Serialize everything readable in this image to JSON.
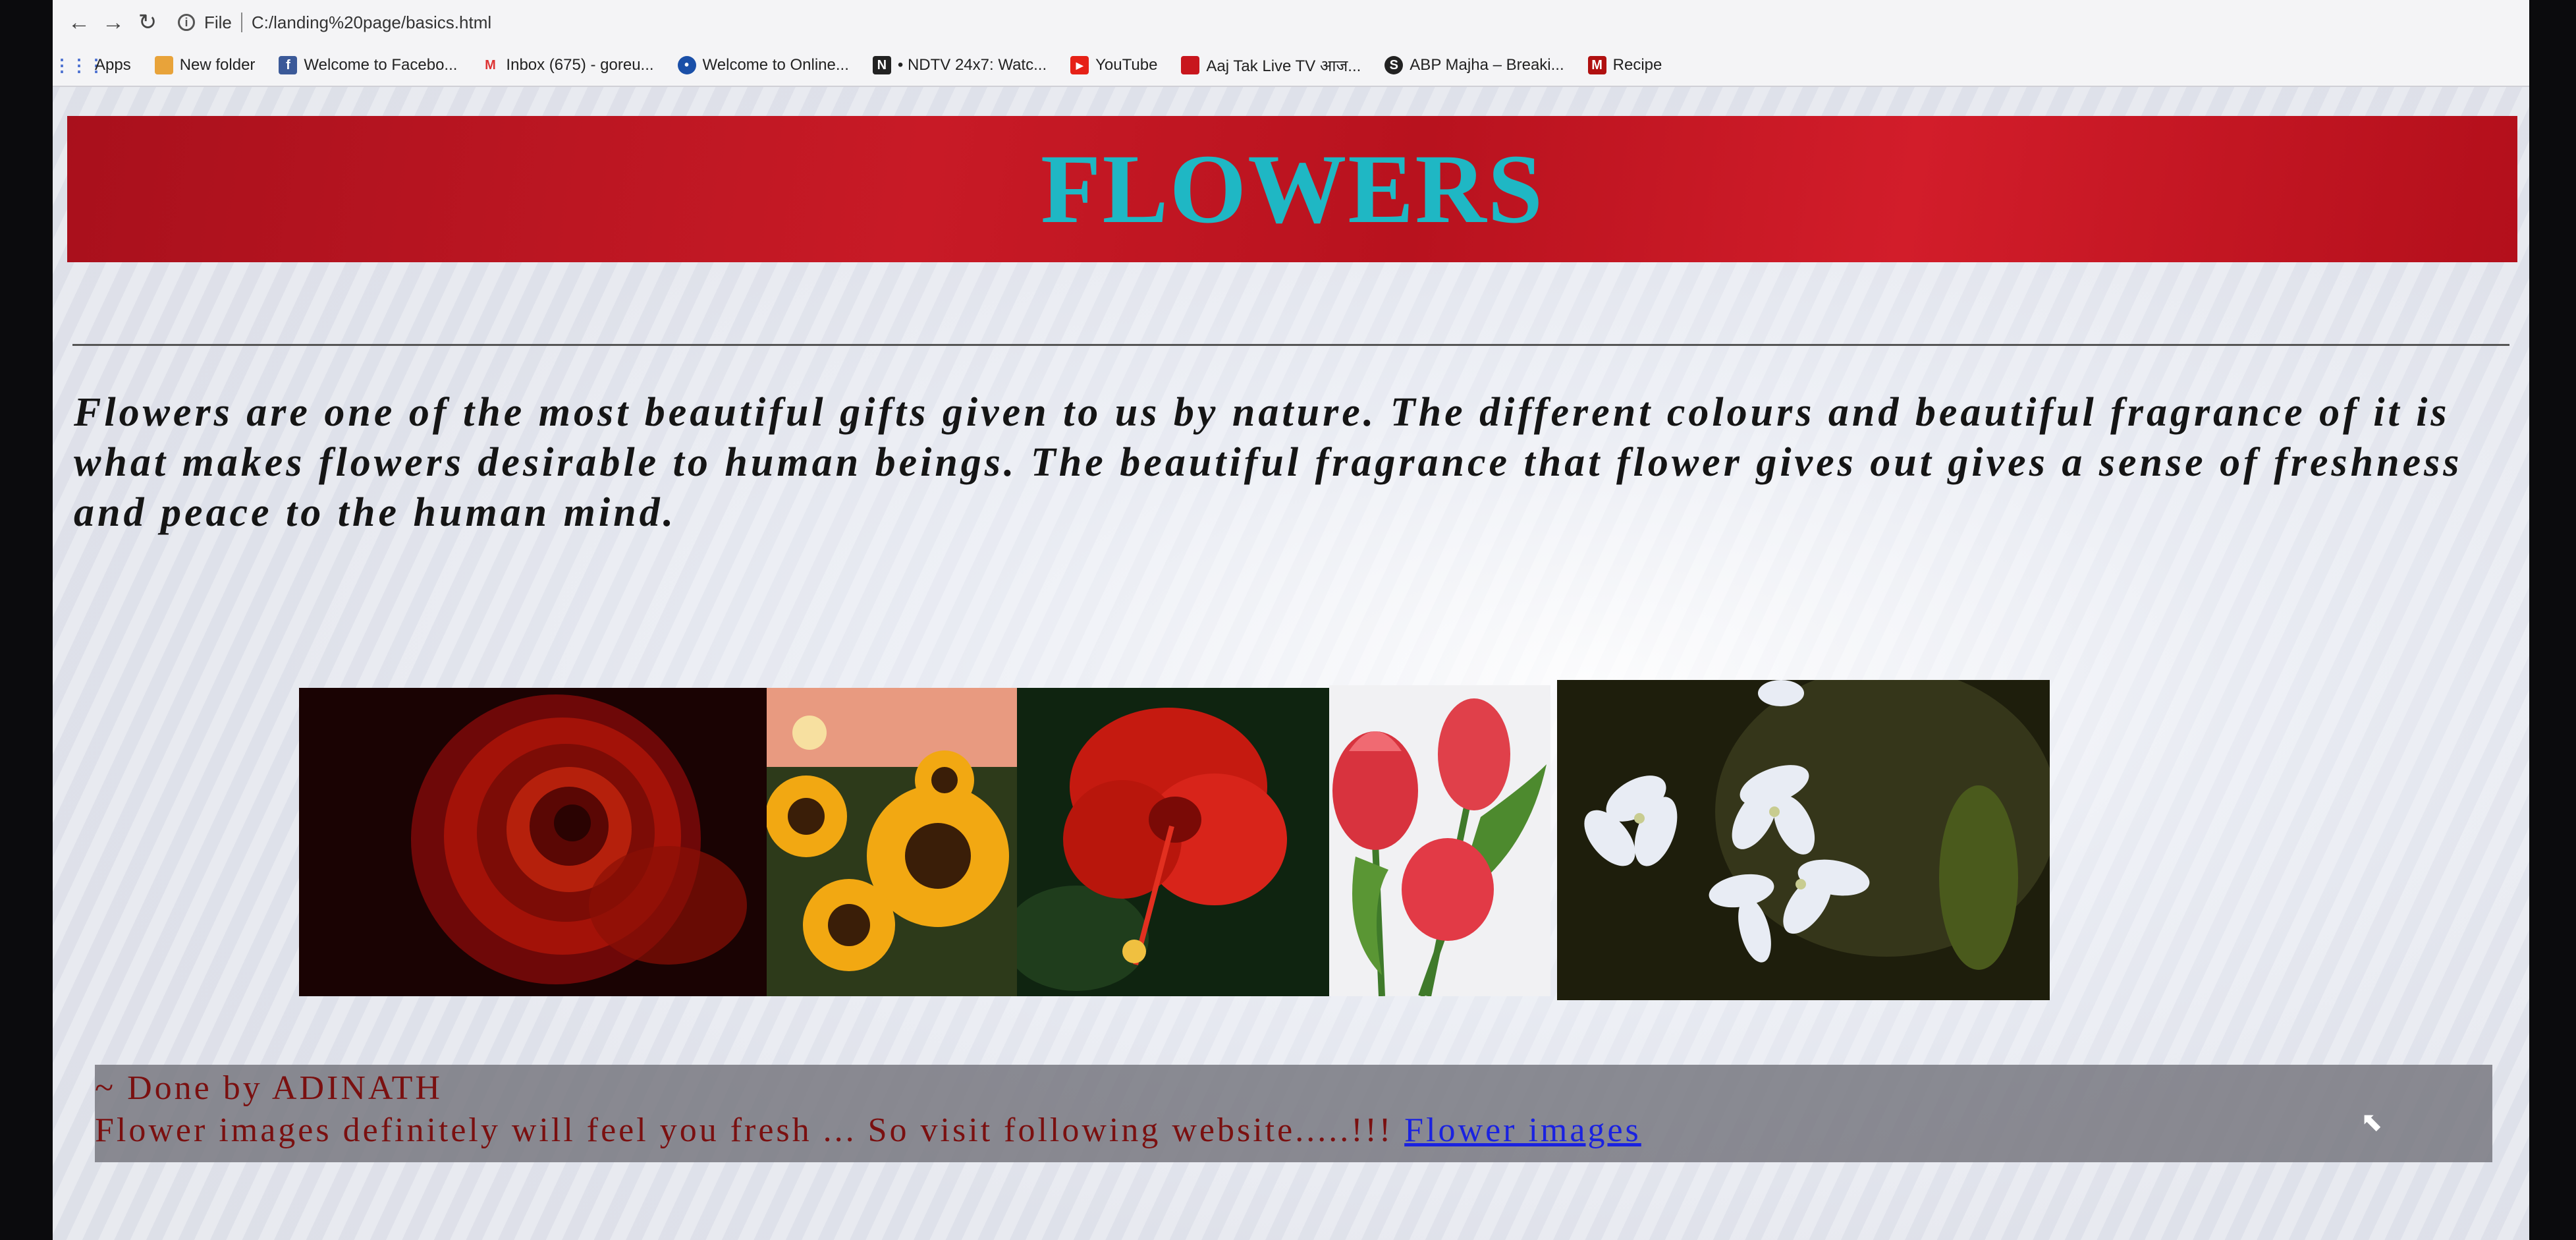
{
  "browser": {
    "protocol_label": "File",
    "url": "C:/landing%20page/basics.html",
    "bookmarks": [
      {
        "label": "Apps",
        "icon": "apps-grid-icon"
      },
      {
        "label": "New folder",
        "icon": "folder-icon"
      },
      {
        "label": "Welcome to Facebo...",
        "icon": "facebook-icon"
      },
      {
        "label": "Inbox (675) - goreu...",
        "icon": "gmail-icon"
      },
      {
        "label": "Welcome to Online...",
        "icon": "globe-icon"
      },
      {
        "label": "• NDTV 24x7: Watc...",
        "icon": "ndtv-icon"
      },
      {
        "label": "YouTube",
        "icon": "youtube-icon"
      },
      {
        "label": "Aaj Tak Live TV आज...",
        "icon": "aajtak-icon"
      },
      {
        "label": "ABP Majha – Breaki...",
        "icon": "abp-icon"
      },
      {
        "label": "Recipe",
        "icon": "recipe-icon"
      }
    ]
  },
  "page": {
    "title": "FLOWERS",
    "intro": "Flowers are one of the most beautiful gifts given to us by nature. The different colours and beautiful fragrance of it is what makes flowers desirable to human beings. The beautiful fragrance that flower gives out gives a sense of freshness and peace to the human mind.",
    "images": [
      "rose",
      "sunflowers",
      "hibiscus",
      "tulips",
      "jasmine"
    ],
    "footer": {
      "credit": "~ Done by ADINATH",
      "message": "Flower images definitely will feel you fresh ... So visit following website.....!!!",
      "link_label": "Flower images"
    }
  },
  "colors": {
    "header_red": "#c81a26",
    "title_cyan": "#1fb7c4",
    "footer_text": "#7a1010",
    "link_blue": "#1a22e0"
  }
}
